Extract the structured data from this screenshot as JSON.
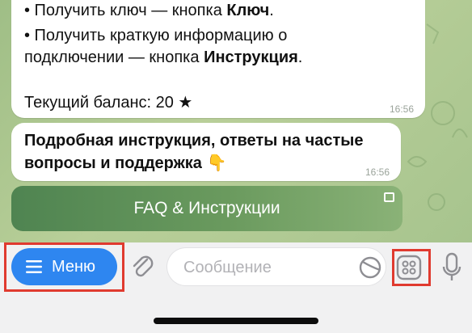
{
  "chat": {
    "message1": {
      "line1_prefix": "• Получить ключ — кнопка ",
      "line1_bold": "Ключ",
      "line1_suffix": ".",
      "line2": "• Получить краткую информацию о",
      "line3_prefix": "подключении — кнопка ",
      "line3_bold": "Инструкция",
      "line3_suffix": ".",
      "balance": "Текущий баланс: 20 ★",
      "time": "16:56"
    },
    "message2": {
      "line1": "Подробная инструкция, ответы на частые",
      "line2": "вопросы и поддержка 👇",
      "time": "16:56"
    },
    "inline_button": {
      "label": "FAQ & Инструкции"
    }
  },
  "input_bar": {
    "menu_label": "Меню",
    "message_placeholder": "Сообщение",
    "icons": [
      "menu-icon",
      "paperclip-icon",
      "sticker-icon",
      "apps-grid-icon",
      "microphone-icon"
    ]
  },
  "colors": {
    "menu_button": "#2e86f0",
    "highlight_box": "#e03a2f",
    "inline_button": "#5e915a"
  }
}
